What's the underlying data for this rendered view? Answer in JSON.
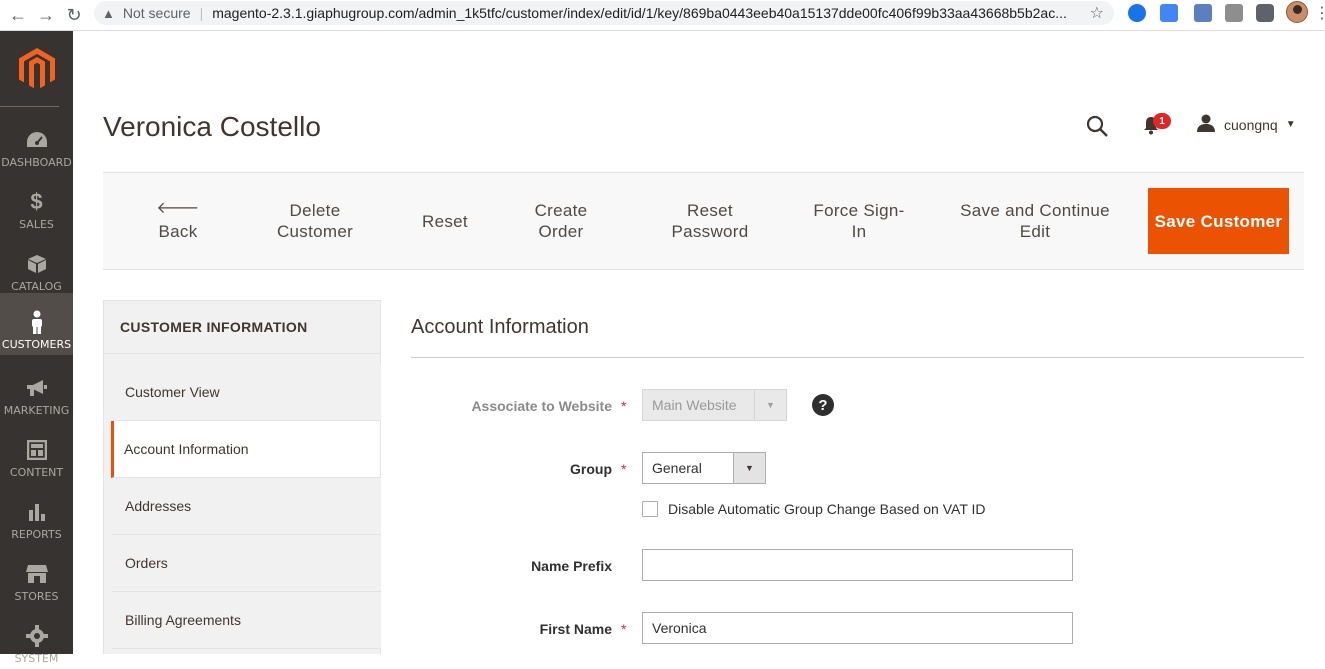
{
  "browser": {
    "security": "Not secure",
    "url": "magento-2.3.1.giaphugroup.com/admin_1k5tfc/customer/index/edit/id/1/key/869ba0443eeb40a15137dde00fc406f99b33aa43668b5b2ac..."
  },
  "menu": [
    {
      "label": "Dashboard",
      "icon": "dashboard-icon"
    },
    {
      "label": "Sales",
      "icon": "dollar-icon"
    },
    {
      "label": "Catalog",
      "icon": "box-icon"
    },
    {
      "label": "Customers",
      "icon": "person-icon",
      "active": true
    },
    {
      "label": "Marketing",
      "icon": "megaphone-icon"
    },
    {
      "label": "Content",
      "icon": "layout-icon"
    },
    {
      "label": "Reports",
      "icon": "bar-chart-icon"
    },
    {
      "label": "Stores",
      "icon": "store-icon"
    },
    {
      "label": "System",
      "icon": "gear-icon"
    }
  ],
  "header": {
    "title": "Veronica Costello",
    "notifications": "1",
    "user": "cuongnq"
  },
  "actions": {
    "back": "Back",
    "delete": "Delete Customer",
    "reset": "Reset",
    "create_order": "Create Order",
    "reset_password": "Reset Password",
    "force_signin": "Force Sign-In",
    "save_continue": "Save and Continue Edit",
    "save": "Save Customer"
  },
  "tabs": {
    "title": "CUSTOMER INFORMATION",
    "items": [
      "Customer View",
      "Account Information",
      "Addresses",
      "Orders",
      "Billing Agreements"
    ],
    "active": "Account Information"
  },
  "form": {
    "section_title": "Account Information",
    "website_label": "Associate to Website",
    "website_value": "Main Website",
    "group_label": "Group",
    "group_value": "General",
    "vat_checkbox_label": "Disable Automatic Group Change Based on VAT ID",
    "vat_checked": false,
    "prefix_label": "Name Prefix",
    "prefix_value": "",
    "firstname_label": "First Name",
    "firstname_value": "Veronica"
  },
  "colors": {
    "accent": "#eb5202",
    "menu_bg": "#373330",
    "menu_active": "#524d49"
  }
}
